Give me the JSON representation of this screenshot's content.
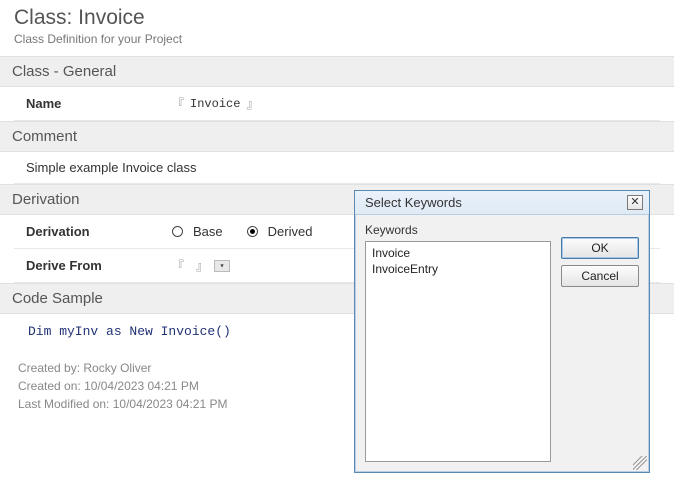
{
  "page": {
    "title": "Class: Invoice",
    "subtitle": "Class Definition for your Project"
  },
  "sections": {
    "general": {
      "header": "Class - General",
      "name_label": "Name",
      "name_value": "Invoice"
    },
    "comment": {
      "header": "Comment",
      "value": "Simple example Invoice class"
    },
    "derivation": {
      "header": "Derivation",
      "label": "Derivation",
      "base_label": "Base",
      "derived_label": "Derived",
      "selected": "Derived",
      "derive_from_label": "Derive From",
      "derive_from_value": ""
    },
    "code_sample": {
      "header": "Code Sample",
      "code": "Dim myInv as New Invoice()"
    }
  },
  "footer": {
    "created_by_label": "Created by:",
    "created_by": "Rocky Oliver",
    "created_on_label": "Created on:",
    "created_on": "10/04/2023 04:21 PM",
    "last_modified_label": "Last Modified on:",
    "last_modified": "10/04/2023 04:21 PM"
  },
  "dialog": {
    "title": "Select Keywords",
    "keywords_label": "Keywords",
    "items": {
      "0": "Invoice",
      "1": "InvoiceEntry"
    },
    "ok": "OK",
    "cancel": "Cancel"
  }
}
